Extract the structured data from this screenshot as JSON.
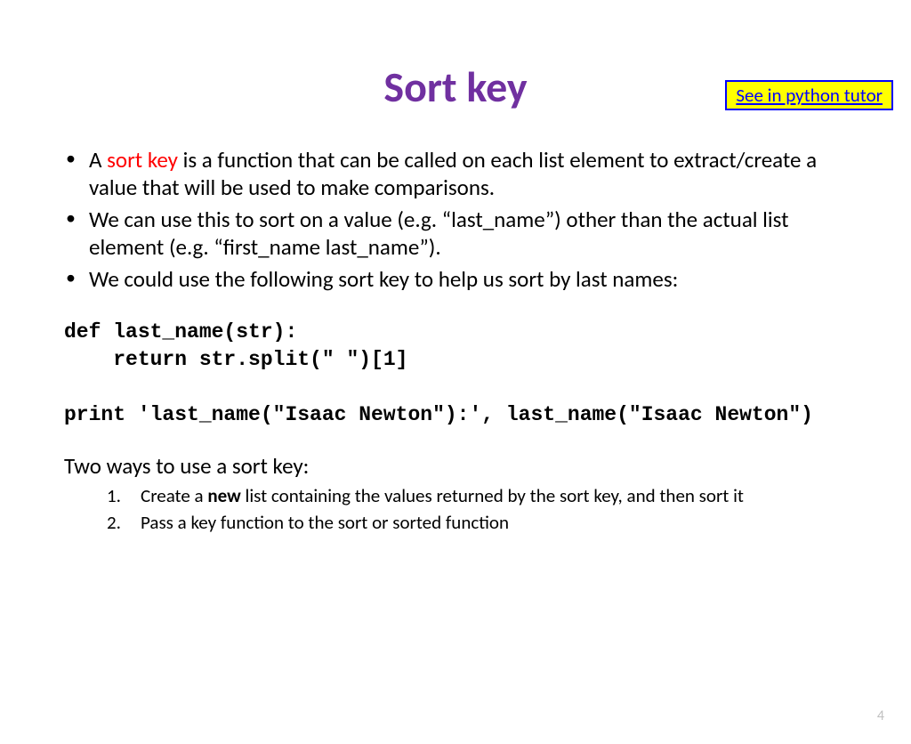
{
  "header": {
    "tutor_link": "See in python tutor",
    "title": "Sort key"
  },
  "bullets": [
    {
      "prefix": "A ",
      "term": "sort key",
      "suffix": " is a function that can be called on each list element to extract/create a value that will be used to make comparisons."
    },
    {
      "text": "We can use this to sort on a value (e.g. “last_name”) other than the actual list element (e.g. “first_name last_name”)."
    },
    {
      "text": "We could use the following sort key to help us sort by last names:"
    }
  ],
  "code": "def last_name(str):\n    return str.split(\" \")[1]\n\nprint 'last_name(\"Isaac Newton\"):', last_name(\"Isaac Newton\")",
  "two_ways": {
    "intro": "Two ways to use a sort key:",
    "items": [
      {
        "prefix": "Create a ",
        "bold": "new",
        "suffix": " list containing the values returned by the sort key, and then sort it"
      },
      {
        "text": "Pass a key function to the sort or sorted function"
      }
    ]
  },
  "page_number": "4"
}
